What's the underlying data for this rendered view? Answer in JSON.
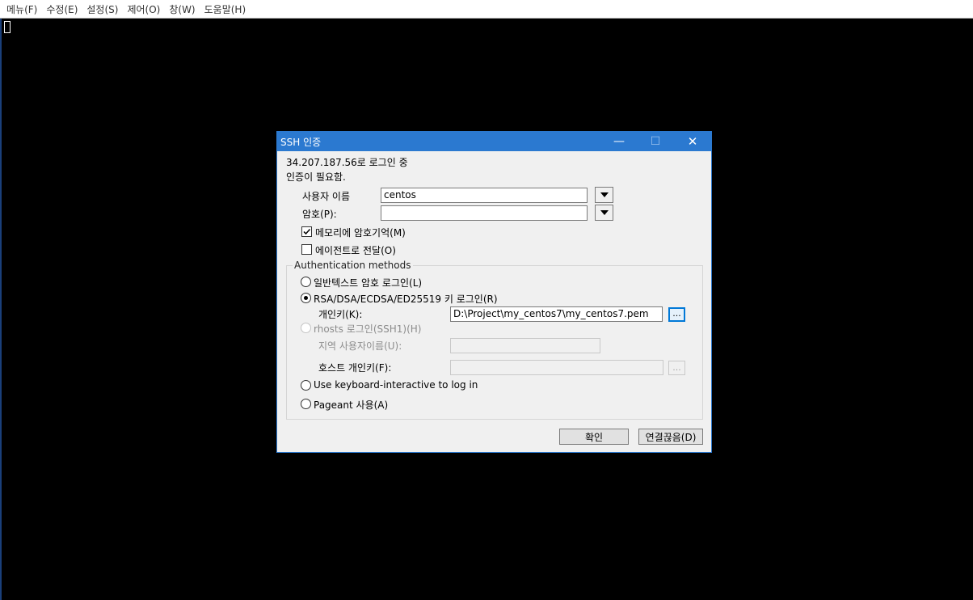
{
  "menubar": {
    "items": [
      "메뉴(F)",
      "수정(E)",
      "설정(S)",
      "제어(O)",
      "창(W)",
      "도움말(H)"
    ]
  },
  "dialog": {
    "title": "SSH 인증",
    "login_status": "34.207.187.56로 로그인 중",
    "auth_required": "인증이 필요함.",
    "username_label": "사용자 이름",
    "username_value": "centos",
    "password_label": "암호(P):",
    "password_value": "",
    "remember_password_label": "메모리에 암호기억(M)",
    "remember_password_checked": true,
    "forward_agent_label": "에이전트로 전달(O)",
    "forward_agent_checked": false,
    "methods_title": "Authentication methods",
    "methods": {
      "plaintext": "일반텍스트 암호 로그인(L)",
      "rsa_key": "RSA/DSA/ECDSA/ED25519 키 로그인(R)",
      "private_key_label": "개인키(K):",
      "private_key_value": "D:\\Project\\my_centos7\\my_centos7.pem",
      "rhosts": "rhosts 로그인(SSH1)(H)",
      "local_user_label": "지역 사용자이름(U):",
      "host_key_label": "호스트 개인키(F):",
      "keyboard_interactive": "Use keyboard-interactive to log in",
      "pageant": "Pageant 사용(A)",
      "selected": "rsa_key"
    },
    "browse_label": "...",
    "ok_label": "확인",
    "disconnect_label": "연결끊음(D)"
  }
}
